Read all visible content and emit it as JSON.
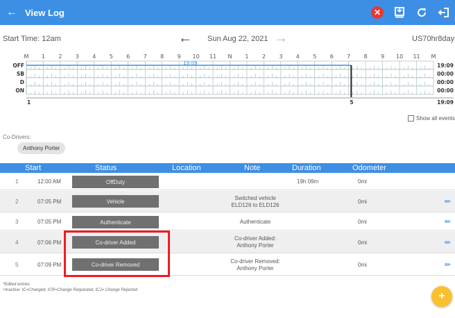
{
  "appbar": {
    "back_icon": "arrow-left-icon",
    "title": "View Log",
    "actions": [
      "close-circle-icon",
      "export-icon",
      "refresh-icon",
      "logout-icon"
    ]
  },
  "nav": {
    "start_time": "Start Time: 12am",
    "date": "Sun Aug 22, 2021",
    "ruleset": "US70hr8days"
  },
  "graph": {
    "hour_labels": [
      "M",
      "1",
      "2",
      "3",
      "4",
      "5",
      "6",
      "7",
      "8",
      "9",
      "10",
      "11",
      "N",
      "1",
      "2",
      "3",
      "4",
      "5",
      "6",
      "7",
      "8",
      "9",
      "10",
      "11",
      "M"
    ],
    "status_labels": [
      "OFF",
      "SB",
      "D",
      "ON"
    ],
    "totals": [
      "19:09",
      "00:00",
      "00:00",
      "00:00"
    ],
    "total_sum": "19:09",
    "event_flag": "19:09",
    "left_marker": "1",
    "right_marker": "5",
    "offduty_until_hour": 19.15
  },
  "show_all_events": "Show all events",
  "co_drivers": {
    "label": "Co-Drivers:",
    "names": [
      "Anthony Porter"
    ]
  },
  "table": {
    "headers": {
      "start": "Start",
      "status": "Status",
      "location": "Location",
      "note": "Note",
      "duration": "Duration",
      "odometer": "Odometer"
    },
    "rows": [
      {
        "num": "1",
        "time": "12:00 AM",
        "status": "OffDuty",
        "note": "",
        "note2": "",
        "duration": "19h 09m",
        "odometer": "0mi",
        "edit": false
      },
      {
        "num": "2",
        "time": "07:05 PM",
        "status": "Vehicle",
        "note": "Switched vehicle",
        "note2": "ELD126 to ELD126",
        "duration": "",
        "odometer": "0mi",
        "edit": true
      },
      {
        "num": "3",
        "time": "07:05 PM",
        "status": "Authenticate",
        "note": "Authenticate",
        "note2": "",
        "duration": "",
        "odometer": "0mi",
        "edit": true
      },
      {
        "num": "4",
        "time": "07:06 PM",
        "status": "Co-driver Added",
        "note": "Co-driver Added:",
        "note2": "Anthony Porter",
        "duration": "",
        "odometer": "0mi",
        "edit": true
      },
      {
        "num": "5",
        "time": "07:09 PM",
        "status": "Co-driver Removed",
        "note": "Co-driver Removed:",
        "note2": "Anthony Porter",
        "duration": "",
        "odometer": "0mi",
        "edit": true
      }
    ]
  },
  "legend": {
    "line1": "*Edited entries",
    "line2": "+Inactive: IC=Changed, ICR=Change Requested, ICJ= Change Rejected"
  },
  "fab_icon": "plus-icon",
  "colors": {
    "primary": "#3d8fe6",
    "highlight": "#ee1c25",
    "status_button": "#707070",
    "fab": "#fbc02d",
    "close": "#e53935"
  }
}
